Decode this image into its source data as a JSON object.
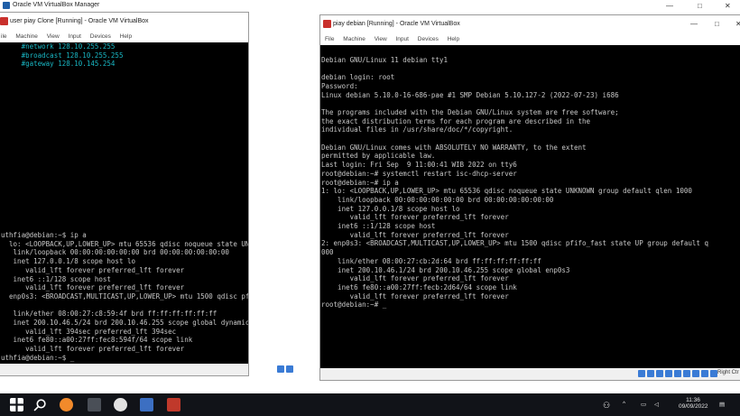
{
  "manager": {
    "title": "Oracle VM VirtualBox Manager",
    "minimize": "—",
    "maximize": "□",
    "close": "✕"
  },
  "left_vm": {
    "title": "user piay Clone [Running] - Oracle VM VirtualBox",
    "menu": [
      "ile",
      "Machine",
      "View",
      "Input",
      "Devices",
      "Help"
    ],
    "term_top": "     #network 128.10.255.255\n     #broadcast 128.10.255.255\n     #gateway 128.10.145.254",
    "term_main": "uthfia@debian:~$ ip a\n  lo: <LOOPBACK,UP,LOWER_UP> mtu 65536 qdisc noqueue state UNKNOWN group de\n   link/loopback 00:00:00:00:00:00 brd 00:00:00:00:00:00\n   inet 127.0.0.1/8 scope host lo\n      valid_lft forever preferred_lft forever\n   inet6 ::1/128 scope host\n      valid_lft forever preferred_lft forever\n  enp0s3: <BROADCAST,MULTICAST,UP,LOWER_UP> mtu 1500 qdisc pfifo_fast state\n\n   link/ether 08:00:27:c8:59:4f brd ff:ff:ff:ff:ff:ff\n   inet 200.10.46.5/24 brd 200.10.46.255 scope global dynamic enp0s3\n      valid_lft 394sec preferred_lft 394sec\n   inet6 fe80::a00:27ff:fec8:594f/64 scope link\n      valid_lft forever preferred_lft forever\nuthfia@debian:~$ _"
  },
  "right_vm": {
    "title": "piay debian [Running] - Oracle VM VirtualBox",
    "menu": [
      "File",
      "Machine",
      "View",
      "Input",
      "Devices",
      "Help"
    ],
    "statusbar_text": "Right Ctr",
    "term": "\nDebian GNU/Linux 11 debian tty1\n\ndebian login: root\nPassword:\nLinux debian 5.10.0-16-686-pae #1 SMP Debian 5.10.127-2 (2022-07-23) i686\n\nThe programs included with the Debian GNU/Linux system are free software;\nthe exact distribution terms for each program are described in the\nindividual files in /usr/share/doc/*/copyright.\n\nDebian GNU/Linux comes with ABSOLUTELY NO WARRANTY, to the extent\npermitted by applicable law.\nLast login: Fri Sep  9 11:00:41 WIB 2022 on tty6\nroot@debian:~# systemctl restart isc-dhcp-server\nroot@debian:~# ip a\n1: lo: <LOOPBACK,UP,LOWER_UP> mtu 65536 qdisc noqueue state UNKNOWN group default qlen 1000\n    link/loopback 00:00:00:00:00:00 brd 00:00:00:00:00:00\n    inet 127.0.0.1/8 scope host lo\n       valid_lft forever preferred_lft forever\n    inet6 ::1/128 scope host\n       valid_lft forever preferred_lft forever\n2: enp0s3: <BROADCAST,MULTICAST,UP,LOWER_UP> mtu 1500 qdisc pfifo_fast state UP group default q\n000\n    link/ether 08:00:27:cb:2d:64 brd ff:ff:ff:ff:ff:ff\n    inet 200.10.46.1/24 brd 200.10.46.255 scope global enp0s3\n       valid_lft forever preferred_lft forever\n    inet6 fe80::a00:27ff:fecb:2d64/64 scope link\n       valid_lft forever preferred_lft forever\nroot@debian:~# _"
  },
  "taskbar": {
    "time": "11:36",
    "date": "09/09/2022"
  },
  "colors": {
    "terminal_bg": "#000000",
    "terminal_fg": "#c8c8c8",
    "comment": "#19b8c5",
    "taskbar": "#111318"
  }
}
